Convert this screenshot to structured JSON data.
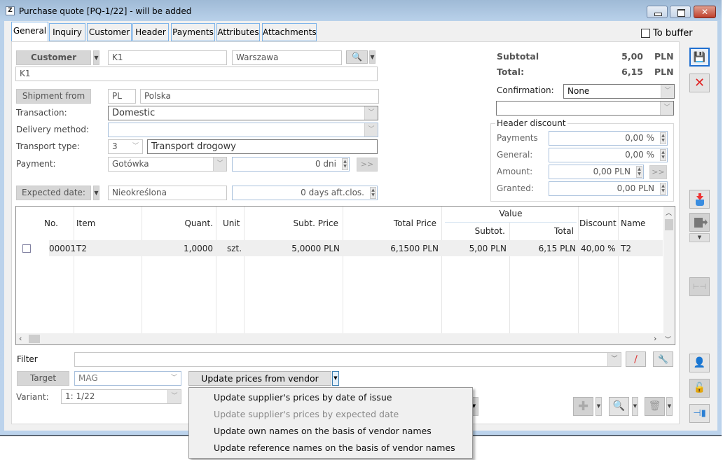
{
  "window": {
    "title": "Purchase quote [PQ-1/22] - will be added",
    "app_icon_glyph": "Z",
    "close_glyph": "✕"
  },
  "tabs": [
    {
      "label": "General",
      "active": true
    },
    {
      "label": "Inquiry"
    },
    {
      "label": "Customer"
    },
    {
      "label": "Header"
    },
    {
      "label": "Payments"
    },
    {
      "label": "Attributes"
    },
    {
      "label": "Attachments"
    }
  ],
  "to_buffer": {
    "label": "To buffer",
    "checked": false
  },
  "customer": {
    "button_label": "Customer",
    "code": "K1",
    "city": "Warszawa",
    "name": "K1"
  },
  "shipment_from": {
    "button_label": "Shipment from",
    "country_code": "PL",
    "country_name": "Polska"
  },
  "transaction": {
    "label": "Transaction:",
    "value": "Domestic"
  },
  "delivery_method": {
    "label": "Delivery method:",
    "value": ""
  },
  "transport_type": {
    "label": "Transport type:",
    "code": "3",
    "name": "Transport drogowy"
  },
  "payment": {
    "label": "Payment:",
    "method": "Gotówka",
    "days": "0 dni",
    "go_label": ">>"
  },
  "expected_date": {
    "button_label": "Expected date:",
    "value": "Nieokreślona",
    "days": "0 days aft.clos."
  },
  "totals": {
    "subtotal_label": "Subtotal",
    "subtotal_value": "5,00",
    "subtotal_currency": "PLN",
    "total_label": "Total:",
    "total_value": "6,15",
    "total_currency": "PLN"
  },
  "confirmation": {
    "label": "Confirmation:",
    "value": "None",
    "second_value": ""
  },
  "header_discount": {
    "title": "Header discount",
    "payments_label": "Payments",
    "payments_value": "0,00 %",
    "general_label": "General:",
    "general_value": "0,00 %",
    "amount_label": "Amount:",
    "amount_value": "0,00 PLN",
    "amount_go": ">>",
    "granted_label": "Granted:",
    "granted_value": "0,00 PLN"
  },
  "grid": {
    "columns": {
      "no": "No.",
      "item": "Item",
      "quant": "Quant.",
      "unit": "Unit",
      "subt_price": "Subt. Price",
      "total_price": "Total Price",
      "value_group": "Value",
      "value_subtot": "Subtot.",
      "value_total": "Total",
      "discount": "Discount",
      "name": "Name"
    },
    "rows": [
      {
        "checked": false,
        "no": "00001",
        "item": "T2",
        "quant": "1,0000",
        "unit": "szt.",
        "subt_price": "5,0000 PLN",
        "total_price": "6,1500 PLN",
        "value_subtot": "5,00 PLN",
        "value_total": "6,15 PLN",
        "discount": "40,00 %",
        "name": "T2"
      }
    ]
  },
  "filter": {
    "label": "Filter",
    "value": ""
  },
  "target": {
    "button_label": "Target",
    "value": "MAG"
  },
  "variant": {
    "label": "Variant:",
    "value": "1:  1/22"
  },
  "update_prices": {
    "button_label": "Update prices from vendor"
  },
  "menu": {
    "items": [
      {
        "label": "Update supplier's prices by date of issue",
        "enabled": true
      },
      {
        "label": "Update supplier's prices by expected date",
        "enabled": false
      },
      {
        "label": "Update own names on the basis of vendor names",
        "enabled": true
      },
      {
        "label": "Update reference names on the basis of vendor names",
        "enabled": true
      }
    ]
  },
  "icons": {
    "search": "🔍",
    "save": "💾",
    "cancel": "✕",
    "add": "✚",
    "delete": "🗑",
    "pin": "📌",
    "lock": "🔓"
  }
}
